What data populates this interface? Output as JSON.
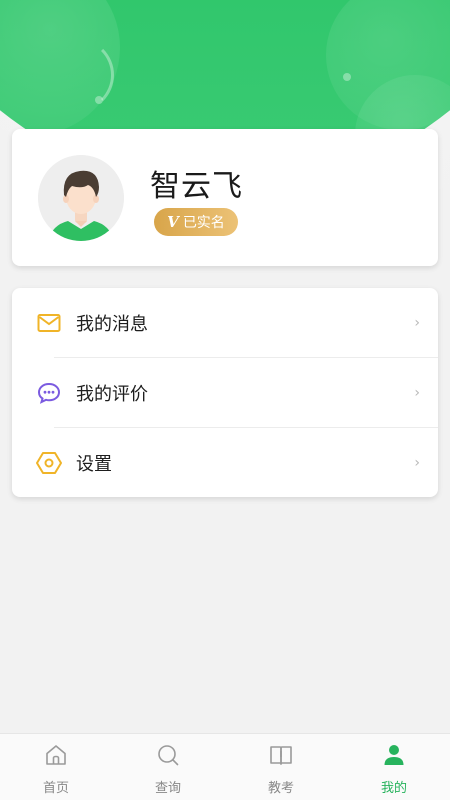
{
  "profile": {
    "name": "智云飞",
    "verified_label": "已实名",
    "verified_mark": "V"
  },
  "menu": {
    "items": [
      {
        "label": "我的消息",
        "icon": "mail-icon",
        "icon_color": "#f0b428"
      },
      {
        "label": "我的评价",
        "icon": "chat-bubble-icon",
        "icon_color": "#7b5be0"
      },
      {
        "label": "设置",
        "icon": "gear-hexagon-icon",
        "icon_color": "#f0b428"
      }
    ],
    "chevron": "›"
  },
  "bottom_nav": {
    "items": [
      {
        "label": "首页",
        "icon": "home-icon",
        "active": false
      },
      {
        "label": "查询",
        "icon": "search-icon",
        "active": false
      },
      {
        "label": "教考",
        "icon": "book-icon",
        "active": false
      },
      {
        "label": "我的",
        "icon": "user-icon",
        "active": true
      }
    ]
  },
  "colors": {
    "brand_green": "#27c264",
    "active_tab": "#27b35d",
    "inactive_tab": "#888888",
    "badge_gold": "#e0b15c"
  }
}
